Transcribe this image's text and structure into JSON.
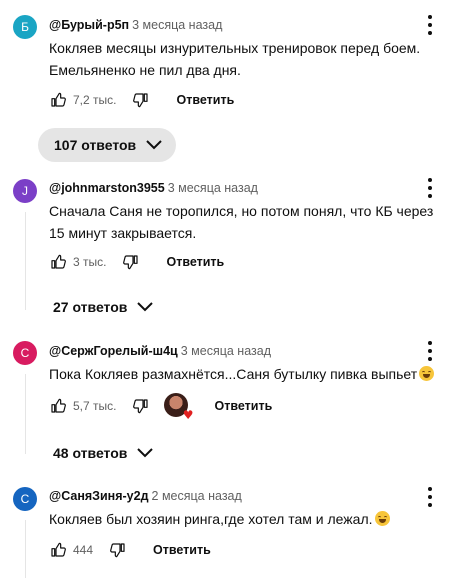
{
  "comments": [
    {
      "avatar_letter": "Б",
      "avatar_color": "#1aa5c4",
      "author": "@Бурый-р5п",
      "time": "3 месяца назад",
      "text_lines": [
        "Кокляев месяцы изнурительных тренировок перед боем.",
        "Емельяненко не пил два дня."
      ],
      "likes": "7,2 тыс.",
      "reply_label": "Ответить",
      "replies_label": "107 ответов"
    },
    {
      "avatar_letter": "J",
      "avatar_color": "#7b3fc7",
      "author": "@johnmarston3955",
      "time": "3 месяца назад",
      "text_lines": [
        "Сначала Саня не торопился, но потом понял, что КБ через",
        "15 минут закрывается."
      ],
      "likes": "3 тыс.",
      "reply_label": "Ответить",
      "replies_label": "27 ответов"
    },
    {
      "avatar_letter": "С",
      "avatar_color": "#d81b60",
      "author": "@СержГорелый-ш4ц",
      "time": "3 месяца назад",
      "text_lines": [
        "Пока Кокляев размахнётся...Саня бутылку пивка выпьет"
      ],
      "likes": "5,7 тыс.",
      "reply_label": "Ответить",
      "replies_label": "48 ответов"
    },
    {
      "avatar_letter": "С",
      "avatar_color": "#1565c0",
      "author": "@СаняЗиня-у2д",
      "time": "2 месяца назад",
      "text_lines": [
        "Кокляев был хозяин ринга,где хотел там и лежал."
      ],
      "likes": "444",
      "reply_label": "Ответить"
    }
  ],
  "icons": {
    "like": "thumb-up-icon",
    "dislike": "thumb-down-icon",
    "menu": "more-vert-icon",
    "expand": "chevron-down-icon",
    "creator_heart": "creator-heart-icon",
    "emoji_laugh": "laughing-emoji",
    "emoji_grin": "grinning-emoji"
  }
}
